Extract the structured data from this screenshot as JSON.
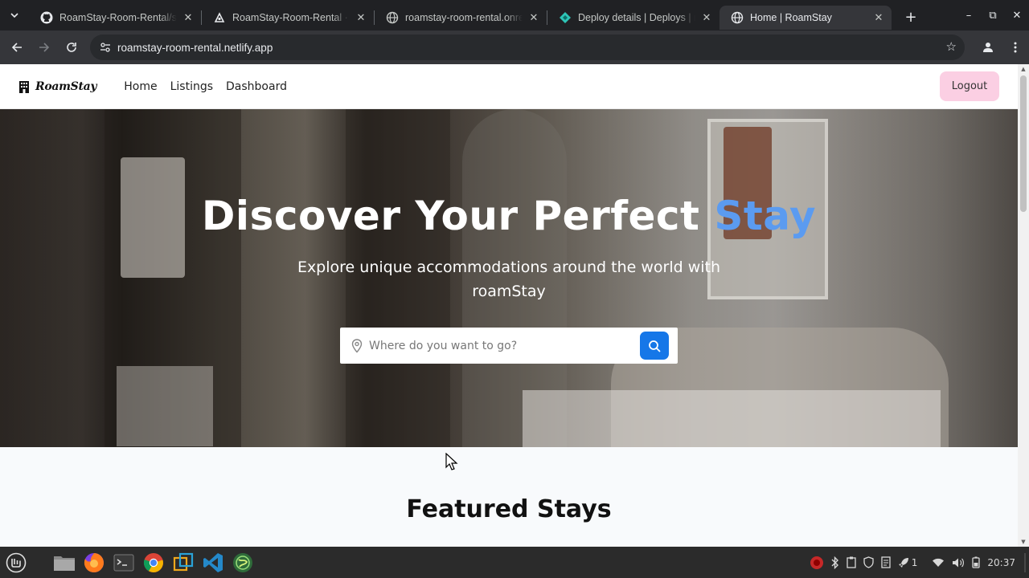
{
  "browser": {
    "tabs": [
      {
        "title": "RoamStay-Room-Rental/se",
        "icon": "github-icon",
        "active": false
      },
      {
        "title": "RoamStay-Room-Rental ·",
        "icon": "netlify-icon",
        "active": false
      },
      {
        "title": "roamstay-room-rental.onre",
        "icon": "globe-icon",
        "active": false
      },
      {
        "title": "Deploy details | Deploys | n",
        "icon": "netlify-diamond-icon",
        "active": false
      },
      {
        "title": "Home | RoamStay",
        "icon": "globe-icon",
        "active": true
      }
    ],
    "url": "roamstay-room-rental.netlify.app"
  },
  "site": {
    "brand": "RoamStay",
    "nav": {
      "home": "Home",
      "listings": "Listings",
      "dashboard": "Dashboard"
    },
    "logout": "Logout"
  },
  "hero": {
    "title_main": "Discover Your Perfect",
    "title_accent": "Stay",
    "subtitle": "Explore unique accommodations around the world with roamStay",
    "search_placeholder": "Where do you want to go?"
  },
  "featured": {
    "title": "Featured Stays"
  },
  "taskbar": {
    "clock": "20:37",
    "workspace_count": "1"
  },
  "colors": {
    "accent": "#5b9bf0",
    "search_button": "#1677e8",
    "logout_bg": "#fbcfe3"
  }
}
